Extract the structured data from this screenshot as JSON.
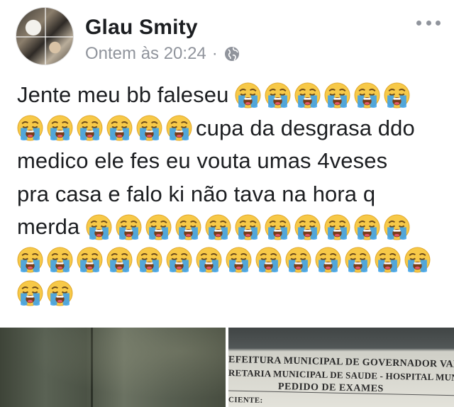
{
  "post": {
    "author": "Glau Smity",
    "timestamp": "Ontem às 20:24",
    "separator": "·",
    "privacy_icon": "globe-icon",
    "more_icon": "more-dots-icon",
    "body_lines": [
      {
        "text": "Jente meu bb faleseu ",
        "emoji_after": 6
      },
      {
        "emoji_before": 6,
        "text": "cupa da desgrasa ddo"
      },
      {
        "text": "medico ele fes eu vouta umas 4veses"
      },
      {
        "text": "pra casa e falo ki não tava na hora q"
      },
      {
        "text": "merda ",
        "emoji_after": 11
      },
      {
        "emoji_after": 14
      },
      {
        "emoji_after": 2
      }
    ],
    "emoji_name": "loudly-crying-face"
  },
  "photos": {
    "left": {
      "name": "photo-wall"
    },
    "right": {
      "name": "photo-document",
      "lines": [
        "EFEITURA MUNICIPAL DE GOVERNADOR VALADARES",
        "RETARIA MUNICIPAL DE SAUDE - HOSPITAL MUNICIPAL",
        "PEDIDO DE EXAMES",
        "CIENTE:"
      ]
    }
  },
  "colors": {
    "text": "#1c1e21",
    "meta": "#90949c",
    "emoji_face": "#f7c948",
    "emoji_tears": "#3fa2e8"
  }
}
